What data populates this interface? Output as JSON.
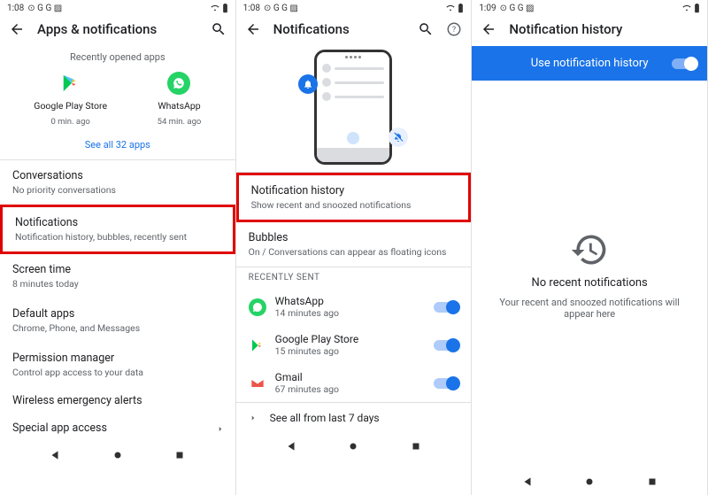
{
  "status": {
    "time1": "1:08",
    "time2": "1:08",
    "time3": "1:09",
    "icons": "⊙ G G ▨"
  },
  "pane1": {
    "title": "Apps & notifications",
    "recently": "Recently opened apps",
    "apps": [
      {
        "name": "Google Play Store",
        "sub": "0 min. ago"
      },
      {
        "name": "WhatsApp",
        "sub": "54 min. ago"
      }
    ],
    "see_all": "See all 32 apps",
    "rows": [
      {
        "t": "Conversations",
        "s": "No priority conversations"
      },
      {
        "t": "Notifications",
        "s": "Notification history, bubbles, recently sent",
        "hl": true
      },
      {
        "t": "Screen time",
        "s": "8 minutes today"
      },
      {
        "t": "Default apps",
        "s": "Chrome, Phone, and Messages"
      },
      {
        "t": "Permission manager",
        "s": "Control app access to your data"
      },
      {
        "t": "Wireless emergency alerts",
        "s": ""
      },
      {
        "t": "Special app access",
        "s": ""
      }
    ]
  },
  "pane2": {
    "title": "Notifications",
    "rows": [
      {
        "t": "Notification history",
        "s": "Show recent and snoozed notifications",
        "hl": true
      },
      {
        "t": "Bubbles",
        "s": "On / Conversations can appear as floating icons"
      }
    ],
    "recently_sent": "RECENTLY SENT",
    "recent": [
      {
        "t": "WhatsApp",
        "s": "14 minutes ago",
        "ico": "wa"
      },
      {
        "t": "Google Play Store",
        "s": "15 minutes ago",
        "ico": "play"
      },
      {
        "t": "Gmail",
        "s": "67 minutes ago",
        "ico": "gm"
      }
    ],
    "see_all": "See all from last 7 days"
  },
  "pane3": {
    "title": "Notification history",
    "bar": "Use notification history",
    "empty_t": "No recent notifications",
    "empty_s": "Your recent and snoozed notifications will appear here"
  }
}
